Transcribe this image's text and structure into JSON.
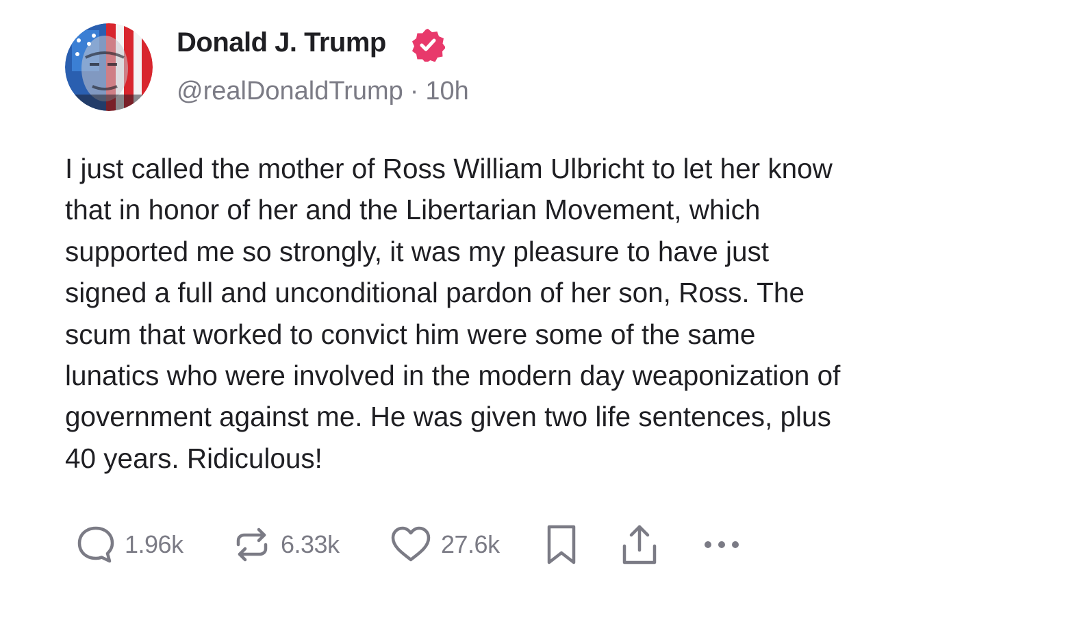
{
  "post": {
    "author": {
      "display_name": "Donald J. Trump",
      "handle": "@realDonaldTrump",
      "time_ago": "10h",
      "separator": "·",
      "verified_color": "#e8396b"
    },
    "text_lines": [
      "I just called the mother of Ross William Ulbricht to let her know",
      "that in honor of her and the Libertarian Movement, which",
      "supported me so strongly, it was my pleasure to have just",
      "signed a full and unconditional pardon of her son, Ross. The",
      "scum that worked to convict him were some of the same",
      "lunatics who were involved in the modern day weaponization of",
      "government against me. He was given two life sentences, plus",
      "40 years. Ridiculous!"
    ],
    "actions": {
      "replies": {
        "icon": "reply-icon",
        "count": "1.96k"
      },
      "reposts": {
        "icon": "repost-icon",
        "count": "6.33k"
      },
      "likes": {
        "icon": "heart-icon",
        "count": "27.6k"
      },
      "bookmark": {
        "icon": "bookmark-icon"
      },
      "share": {
        "icon": "share-icon"
      },
      "more": {
        "icon": "more-icon"
      }
    }
  }
}
